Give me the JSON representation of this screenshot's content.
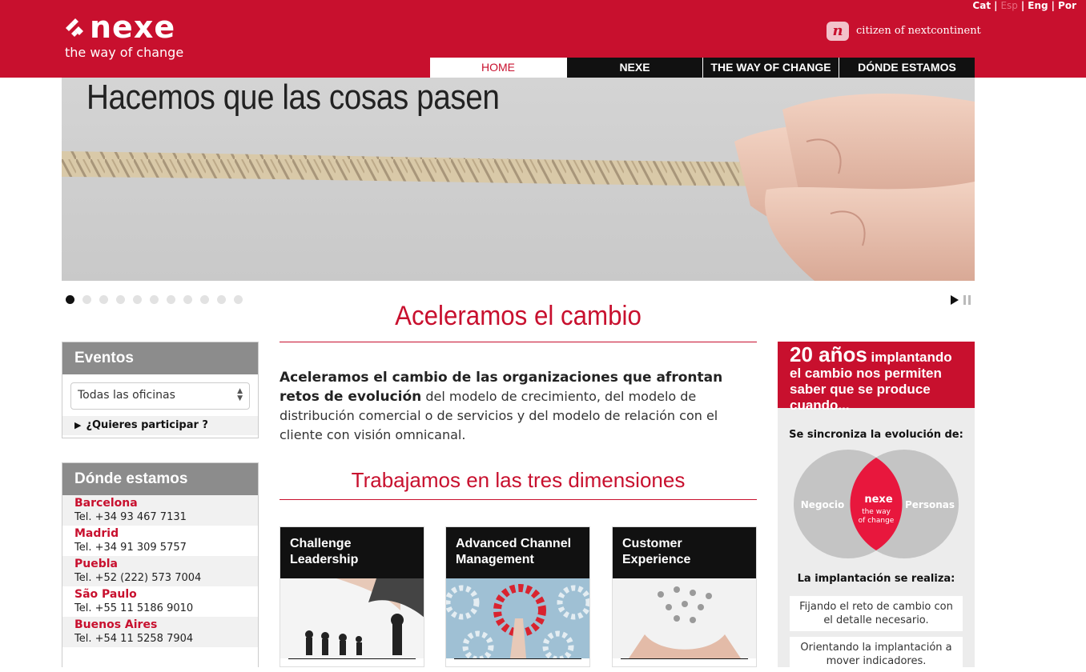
{
  "header": {
    "brand": "nexe",
    "tagline": "the way of change",
    "languages": [
      {
        "label": "Cat",
        "active": false
      },
      {
        "label": "Esp",
        "active": true
      },
      {
        "label": "Eng",
        "active": false
      },
      {
        "label": "Por",
        "active": false
      }
    ],
    "language_separator": "|",
    "citizen_badge": "n",
    "citizen_text": "citizen of nextcontinent"
  },
  "nav": {
    "items": [
      {
        "label": "HOME",
        "active": true
      },
      {
        "label": "NEXE",
        "active": false
      },
      {
        "label": "THE WAY OF CHANGE",
        "active": false
      },
      {
        "label": "DÓNDE ESTAMOS",
        "active": false
      }
    ]
  },
  "hero": {
    "title": "Hacemos que las cosas pasen",
    "slide_count": 11,
    "active_slide": 1
  },
  "main": {
    "title": "Aceleramos el cambio",
    "intro_bold": "Aceleramos el cambio de las organizaciones que afrontan retos de evolución",
    "intro_rest": " del modelo de crecimiento, del modelo de distribución comercial o de servicios y del modelo de relación con el cliente con visión omnicanal.",
    "dimensions_title": "Trabajamos en las tres dimensiones",
    "cards": [
      {
        "title": "Challenge Leadership"
      },
      {
        "title": "Advanced Channel Management"
      },
      {
        "title": "Customer Experience"
      }
    ]
  },
  "sidebar": {
    "events": {
      "title": "Eventos",
      "select_value": "Todas las oficinas",
      "participate_label": "¿Quieres participar ?"
    },
    "locations": {
      "title": "Dónde estamos",
      "offices": [
        {
          "city": "Barcelona",
          "tel": "Tel. +34 93 467 7131"
        },
        {
          "city": "Madrid",
          "tel": "Tel. +34 91 309 5757"
        },
        {
          "city": "Puebla",
          "tel": "Tel. +52 (222) 573 7004"
        },
        {
          "city": "São Paulo",
          "tel": "Tel. +55 11 5186 9010"
        },
        {
          "city": "Buenos Aires",
          "tel": "Tel. +54 11 5258 7904"
        }
      ]
    }
  },
  "right": {
    "head_big": "20 años",
    "head_rest": " implantando el cambio nos permiten saber que se produce cuando...",
    "sync_title": "Se sincroniza la evolución de:",
    "venn_left": "Negocio",
    "venn_right": "Personas",
    "venn_center_brand": "nexe",
    "venn_center_line1": "the way",
    "venn_center_line2": "of change",
    "impl_title": "La implantación se realiza:",
    "impl_items": [
      "Fijando el reto de cambio con el detalle necesario.",
      "Orientando la implantación a mover indicadores."
    ]
  },
  "colors": {
    "brand_red": "#c8102e",
    "nav_dark": "#111111",
    "panel_gray": "#8c8c8c"
  }
}
